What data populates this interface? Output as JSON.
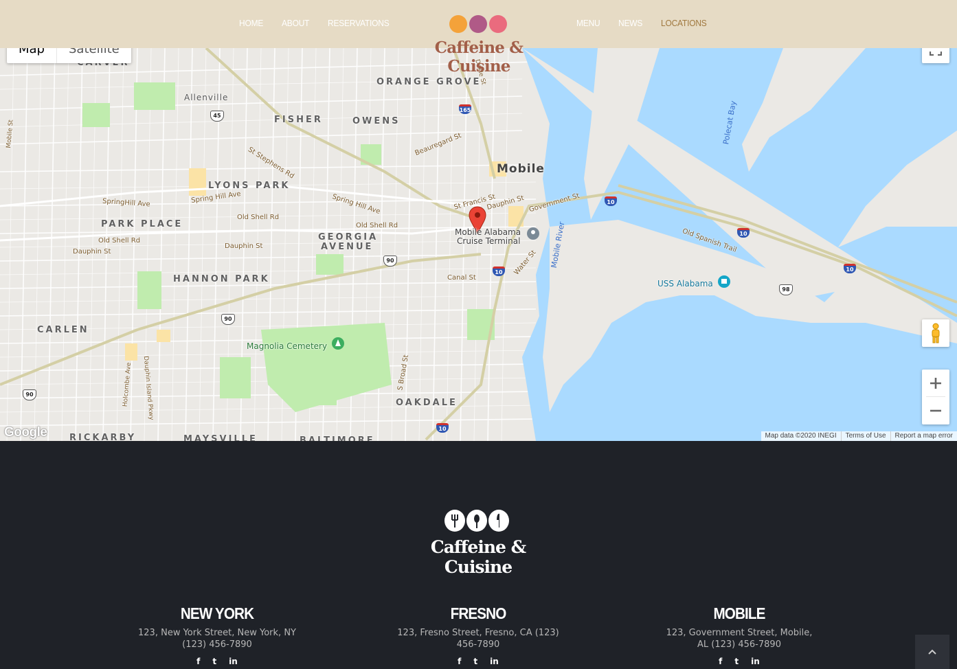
{
  "header": {
    "nav_left": [
      "HOME",
      "ABOUT",
      "RESERVATIONS"
    ],
    "nav_right": [
      "MENU",
      "NEWS",
      "LOCATIONS"
    ],
    "logo_text": "Caffeine & Cuisine",
    "current_page": "LOCATIONS"
  },
  "map": {
    "type_controls": [
      "Map",
      "Satellite"
    ],
    "active_type": "Map",
    "city_label": "Mobile",
    "neighborhoods": [
      "CARVER",
      "ORANGE GROVE",
      "Allenville",
      "FISHER",
      "OWENS",
      "LYONS PARK",
      "PARK PLACE",
      "GEORGIA",
      "AVENUE",
      "HANNON PARK",
      "CARLEN",
      "OAKDALE",
      "RICKARBY",
      "MAYSVILLE",
      "BALTIMORE"
    ],
    "roads": [
      "Beauregard St",
      "St Stephens Rd",
      "SpringHill Ave",
      "Spring Hill Ave",
      "Spring Hill Ave",
      "Old Shell Rd",
      "Old Shell Rd",
      "Old Shell Rd",
      "Dauphin St",
      "Dauphin St",
      "Dauphin St",
      "St Francis St",
      "Government St",
      "Water St",
      "Canal St",
      "Old Spanish Trail",
      "S Broad St",
      "Holcombe Ave",
      "Dauphin Island Pkwy",
      "Mobile St",
      "Mobile River",
      "Polecat Bay",
      "Dekle St"
    ],
    "pois": [
      "Mobile Alabama",
      "Cruise Terminal",
      "Magnolia Cemetery",
      "USS Alabama"
    ],
    "shields": [
      "45",
      "165",
      "90",
      "90",
      "90",
      "10",
      "10",
      "10",
      "10",
      "10",
      "98"
    ],
    "attribution": [
      "Map data ©2020 INEGI",
      "Terms of Use",
      "Report a map error"
    ],
    "google_logo": "Google"
  },
  "footer": {
    "logo_text": "Caffeine & Cuisine",
    "locations": [
      {
        "name": "NEW YORK",
        "address": "123, New York Street, New York, NY",
        "phone": "(123) 456-7890"
      },
      {
        "name": "FRESNO",
        "address": "123, Fresno Street, Fresno, CA (123)",
        "phone": "456-7890"
      },
      {
        "name": "MOBILE",
        "address": "123, Government Street, Mobile,",
        "phone": "AL (123) 456-7890"
      }
    ],
    "social_icons": [
      "f",
      "t",
      "in"
    ]
  },
  "colors": {
    "header_bg": "#e6dbc5",
    "nav_active": "#a0783e",
    "footer_bg": "#1f2228",
    "water": "#aadaff",
    "park": "#c0ecae"
  }
}
